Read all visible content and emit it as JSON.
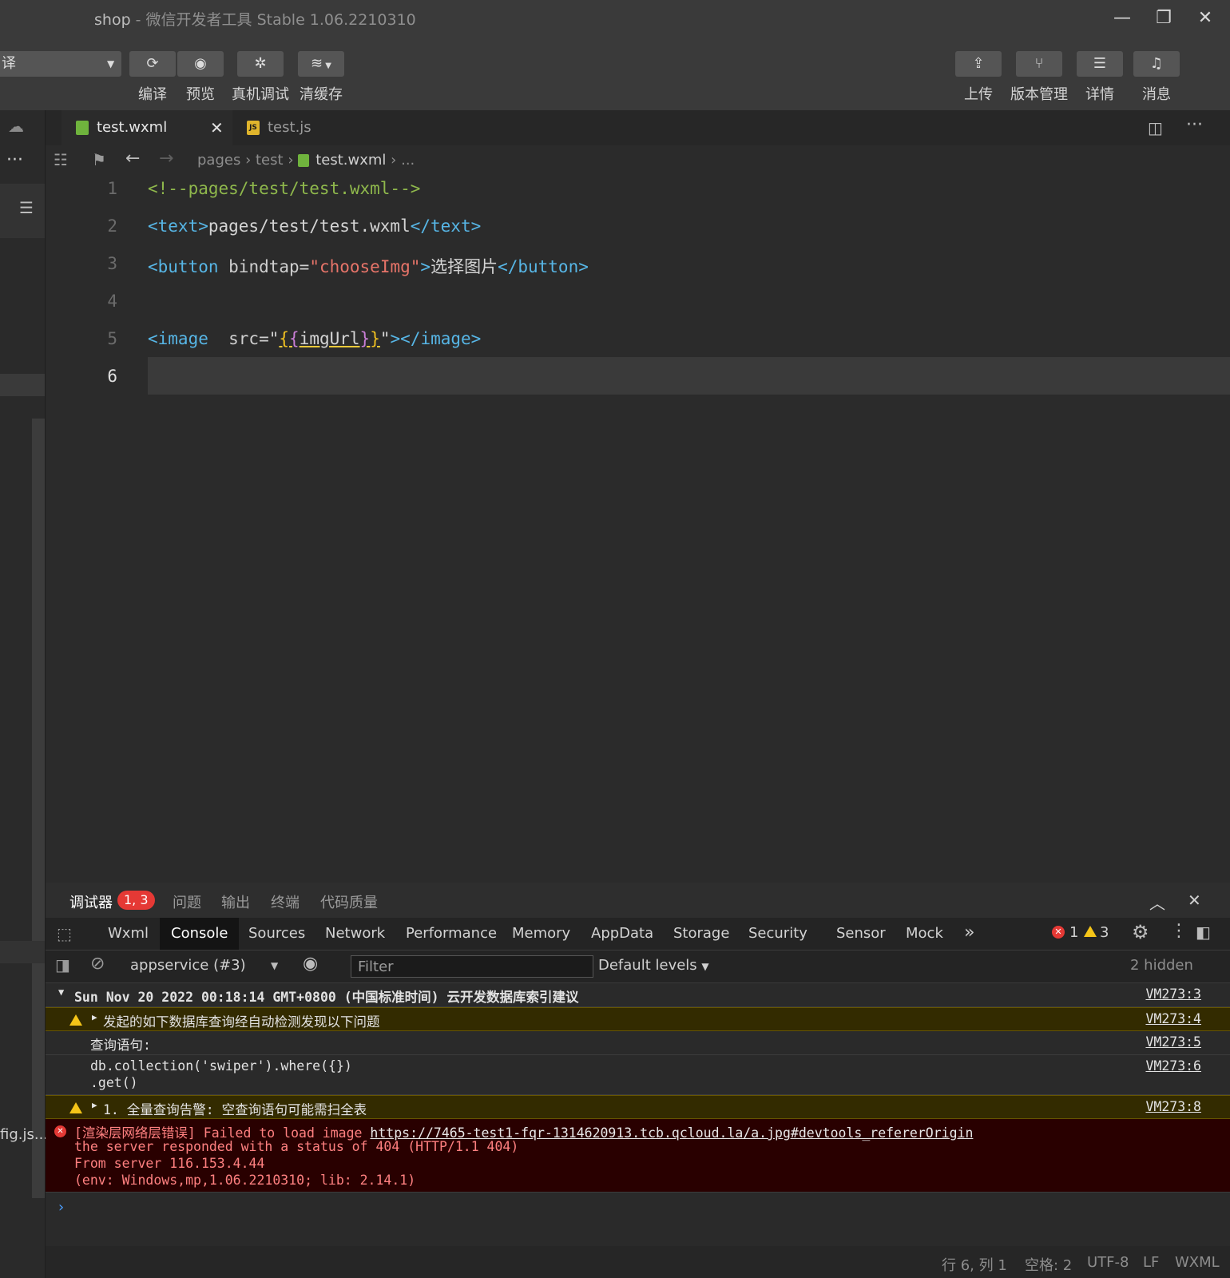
{
  "window": {
    "project": "shop",
    "app_title": "- 微信开发者工具 Stable 1.06.2210310"
  },
  "toolbar": {
    "mode_partial": "译",
    "compile": "编译",
    "preview": "预览",
    "remote_debug": "真机调试",
    "clear_cache": "清缓存",
    "upload": "上传",
    "version": "版本管理",
    "details": "详情",
    "messages": "消息"
  },
  "leftstrip": {
    "partial_file": "fig.js..."
  },
  "tabs": [
    {
      "label": "test.wxml",
      "type": "wxml"
    },
    {
      "label": "test.js",
      "type": "js",
      "icon_text": "JS"
    }
  ],
  "breadcrumb": {
    "seg1": "pages",
    "seg2": "test",
    "file": "test.wxml",
    "more": "..."
  },
  "editor": {
    "line_numbers": [
      "1",
      "2",
      "3",
      "4",
      "5",
      "6"
    ],
    "line1": "<!--pages/test/test.wxml-->",
    "l2_open": "<text>",
    "l2_content": "pages/test/test.wxml",
    "l2_close": "</text>",
    "l3_open": "<button",
    "l3_attr": " bindtap=",
    "l3_q1": "\"",
    "l3_value": "chooseImg",
    "l3_q2": "\"",
    "l3_gt": ">",
    "l3_content": "选择图片",
    "l3_close": "</button>",
    "l5_open": "<image",
    "l5_attr": "  src=\"",
    "l5_b1": "{",
    "l5_b2": "{",
    "l5_var": "imgUrl",
    "l5_b3": "}",
    "l5_b4": "}",
    "l5_q": "\"",
    "l5_gt": ">",
    "l5_close": "</image>"
  },
  "panel": {
    "tabs": [
      "调试器",
      "问题",
      "输出",
      "终端",
      "代码质量"
    ],
    "badge": "1, 3",
    "devtabs": [
      "Wxml",
      "Console",
      "Sources",
      "Network",
      "Performance",
      "Memory",
      "AppData",
      "Storage",
      "Security",
      "Sensor",
      "Mock"
    ],
    "error_count": "1",
    "warning_count": "3",
    "context": "appservice (#3)",
    "filter_placeholder": "Filter",
    "levels": "Default levels",
    "hidden": "2 hidden"
  },
  "console": {
    "group_header": "Sun Nov 20 2022 00:18:14 GMT+0800 (中国标准时间) 云开发数据库索引建议",
    "group_src": "VM273:3",
    "warn1": "发起的如下数据库查询经自动检测发现以下问题",
    "warn1_src": "VM273:4",
    "query_label": "查询语句:",
    "query_label_src": "VM273:5",
    "query_line1": "db.collection('swiper').where({})",
    "query_line2": ".get()",
    "query_src": "VM273:6",
    "warn2": "1. 全量查询告警: 空查询语句可能需扫全表",
    "warn2_src": "VM273:8",
    "err_prefix": "[渲染层网络层错误] Failed to load image ",
    "err_url": "https://7465-test1-fqr-1314620913.tcb.qcloud.la/a.jpg#devtools_refererOrigin",
    "err_line2": "the server responded with a status of 404 (HTTP/1.1 404)",
    "err_line3": "From server 116.153.4.44",
    "err_line4": "(env: Windows,mp,1.06.2210310; lib: 2.14.1)"
  },
  "statusbar": {
    "position": "行 6, 列 1",
    "spaces": "空格: 2",
    "encoding": "UTF-8",
    "eol": "LF",
    "lang": "WXML"
  },
  "colors": {
    "accent_error": "#e53935",
    "warning": "#f5c518"
  }
}
